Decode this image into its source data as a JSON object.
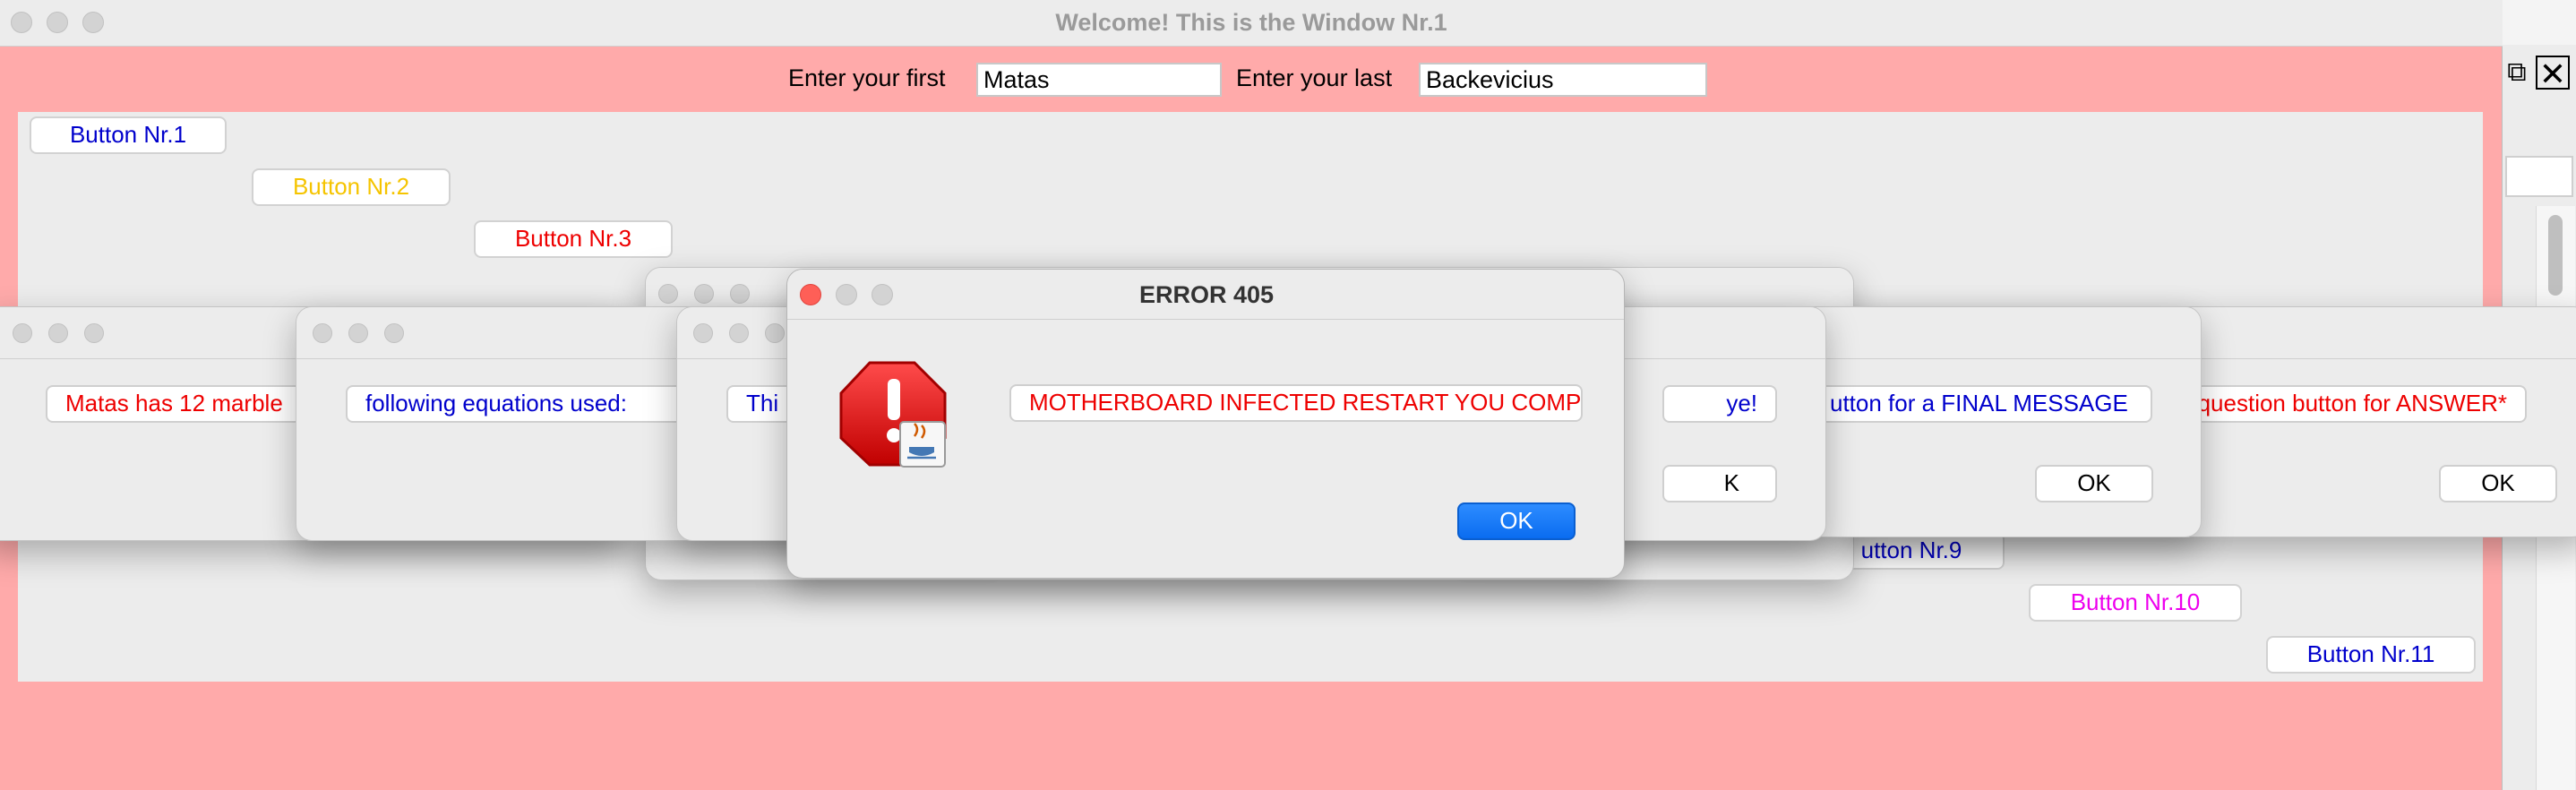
{
  "main_window": {
    "title": "Welcome! This is the Window Nr.1",
    "first_label": "Enter your first",
    "first_value": "Matas",
    "last_label": "Enter your last",
    "last_value": "Backevicius"
  },
  "buttons": [
    {
      "label": "Button Nr.1",
      "color": "#0000cc"
    },
    {
      "label": "Button Nr.2",
      "color": "#f5c400"
    },
    {
      "label": "Button Nr.3",
      "color": "#ee0000"
    },
    {
      "label": "utton Nr.9",
      "color": "#0000cc"
    },
    {
      "label": "Button Nr.10",
      "color": "#ee00ee"
    },
    {
      "label": "Button Nr.11",
      "color": "#0000cc"
    }
  ],
  "dialogs": [
    {
      "message": "Matas has 12 marble",
      "color": "#ee0000"
    },
    {
      "message": "following equations used:",
      "color": "#0000cc"
    },
    {
      "message": "Thi",
      "color": "#0000cc"
    },
    {
      "message": "ye!",
      "color": "#0000cc",
      "ok": "K"
    },
    {
      "message": "utton for a FINAL MESSAGE",
      "color": "#0000cc",
      "ok": "OK"
    },
    {
      "message": "question button for ANSWER*",
      "color": "#ee0000",
      "ok": "OK"
    }
  ],
  "error_dialog": {
    "title": "ERROR 405",
    "message": "MOTHERBOARD INFECTED RESTART YOU COMPUTER.",
    "message_color": "#ee0000",
    "ok": "OK"
  },
  "colors": {
    "pink_background": "#ffaaaa",
    "panel_gray": "#ececec"
  }
}
